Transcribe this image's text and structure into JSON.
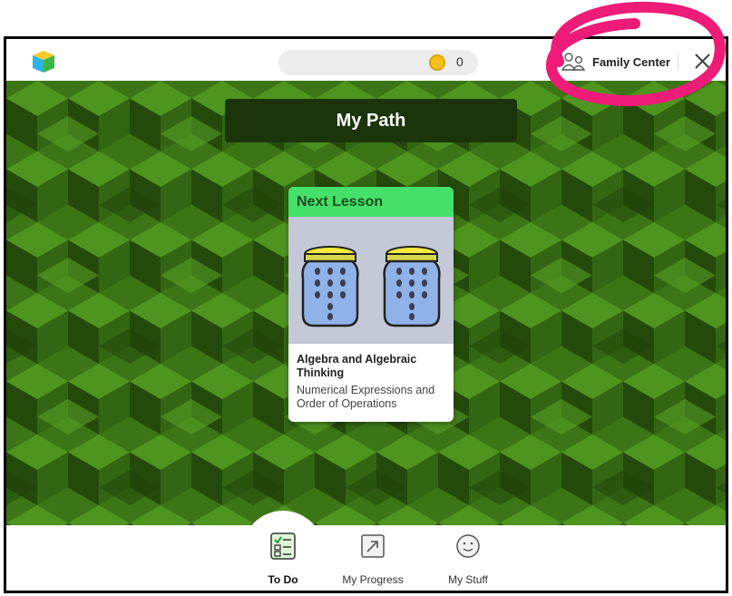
{
  "header": {
    "coin_count": "0",
    "family_label": "Family Center"
  },
  "main": {
    "title": "My Path",
    "card": {
      "heading": "Next Lesson",
      "subject": "Algebra and Algebraic Thinking",
      "topic": "Numerical Expressions and Order of Operations"
    }
  },
  "nav": {
    "items": [
      {
        "label": "To Do",
        "icon": "todo-checklist-icon",
        "active": true
      },
      {
        "label": "My Progress",
        "icon": "progress-arrow-icon",
        "active": false
      },
      {
        "label": "My Stuff",
        "icon": "smiley-face-icon",
        "active": false
      }
    ]
  },
  "colors": {
    "background_green": "#3f7a1a",
    "title_bar": "#1b3409",
    "card_header": "#45e06a",
    "annotation": "#ee1c78"
  }
}
